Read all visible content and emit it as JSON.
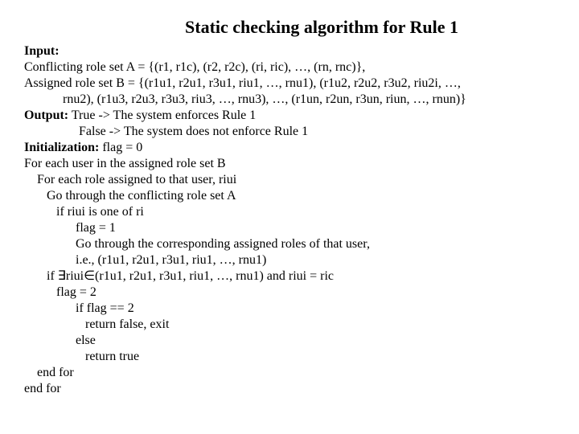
{
  "title": "Static checking algorithm for Rule 1",
  "input_label": "Input:",
  "conflicting": "Conflicting role set A = {(r1, r1c), (r2, r2c), (ri, ric), …, (rn, rnc)},",
  "assigned1": "Assigned role set B = {(r1u1, r2u1, r3u1, riu1, …, rnu1), (r1u2, r2u2, r3u2, riu2i, …,",
  "assigned2": "rnu2), (r1u3, r2u3, r3u3, riu3, …, rnu3), …, (r1un, r2un, r3un, riun, …, rnun)}",
  "output_label": "Output:",
  "output_true": "True -> The system enforces Rule 1",
  "output_false": "False -> The system does not enforce Rule 1",
  "init_label": "Initialization:",
  "init_val": " flag = 0",
  "l1": "For each user in the assigned role set B",
  "l2": "For each role assigned to that user, riui",
  "l3": "Go through the conflicting role set A",
  "l4": "if riui is one of ri",
  "l5": "flag = 1",
  "l6": "Go through the corresponding assigned roles of that user,",
  "l7": "i.e., (r1u1, r2u1, r3u1, riu1, …, rnu1)",
  "l8": "if ∃riui∈(r1u1, r2u1, r3u1, riu1, …, rnu1) and riui = ric",
  "l9": "flag = 2",
  "l10": "if flag == 2",
  "l11": "return false, exit",
  "l12": "else",
  "l13": "return true",
  "l14": "end for",
  "l15": "end for"
}
